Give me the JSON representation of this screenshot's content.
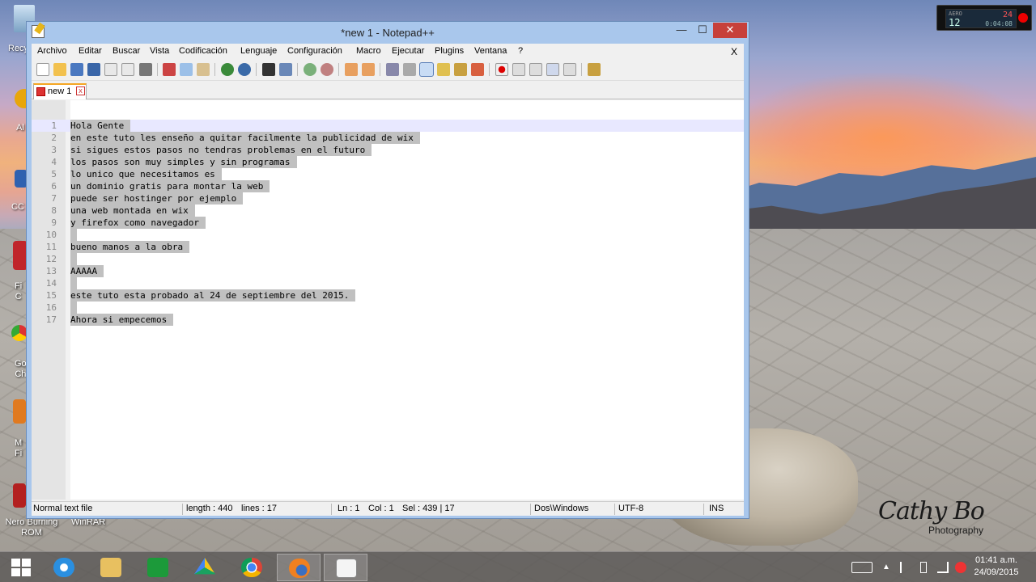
{
  "window": {
    "title": "*new 1 - Notepad++",
    "min": "—",
    "max": "☐",
    "close": "✕"
  },
  "menu": [
    "Archivo",
    "Editar",
    "Buscar",
    "Vista",
    "Codificación",
    "Lenguaje",
    "Configuración",
    "Macro",
    "Ejecutar",
    "Plugins",
    "Ventana",
    "?"
  ],
  "menu_close": "X",
  "tab": {
    "label": "new 1",
    "close": "x"
  },
  "editor": {
    "lines": [
      {
        "n": "1",
        "text": "Hola Gente"
      },
      {
        "n": "2",
        "text": "en este tuto les enseño a quitar facilmente la publicidad de wix"
      },
      {
        "n": "3",
        "text": "si sigues estos pasos no tendras problemas en el futuro"
      },
      {
        "n": "4",
        "text": "los pasos son muy simples y sin programas"
      },
      {
        "n": "5",
        "text": "lo unico que necesitamos es"
      },
      {
        "n": "6",
        "text": "un dominio gratis para montar la web"
      },
      {
        "n": "7",
        "text": "puede ser hostinger por ejemplo"
      },
      {
        "n": "8",
        "text": "una web montada en wix"
      },
      {
        "n": "9",
        "text": "y firefox como navegador"
      },
      {
        "n": "10",
        "text": ""
      },
      {
        "n": "11",
        "text": "bueno manos a la obra"
      },
      {
        "n": "12",
        "text": ""
      },
      {
        "n": "13",
        "text": "AAAAA"
      },
      {
        "n": "14",
        "text": ""
      },
      {
        "n": "15",
        "text": "este tuto esta probado al 24 de septiembre del 2015."
      },
      {
        "n": "16",
        "text": ""
      },
      {
        "n": "17",
        "text": "Ahora si empecemos"
      }
    ]
  },
  "status": {
    "type": "Normal text file",
    "length": "length : 440",
    "lines": "lines : 17",
    "ln": "Ln : 1",
    "col": "Col : 1",
    "sel": "Sel : 439 | 17",
    "eol": "Dos\\Windows",
    "encoding": "UTF-8",
    "mode": "INS"
  },
  "desktop": {
    "icons": [
      {
        "label": "Recy",
        "name": "recycle-bin"
      },
      {
        "label": "Al",
        "name": "desktop-shortcut"
      },
      {
        "label": "CC",
        "name": "desktop-shortcut"
      },
      {
        "label": "Fi\nC",
        "name": "desktop-shortcut"
      },
      {
        "label": "Go\nCh",
        "name": "desktop-shortcut"
      },
      {
        "label": "M\nFi",
        "name": "desktop-shortcut"
      },
      {
        "label": "Nero Burning\nROM",
        "name": "nero-burning-rom"
      },
      {
        "label": "WinRAR",
        "name": "winrar"
      }
    ],
    "photo_credit": "Photography",
    "photo_signature": "Cathy Bo"
  },
  "recorder": {
    "label": "AERO",
    "num": "12",
    "sec": "24",
    "time": "0:04:08"
  },
  "taskbar": {
    "time": "01:41 a.m.",
    "date": "24/09/2015"
  },
  "colors": {
    "selection": "#c0c0c0",
    "window_frame": "#a9c7ec",
    "close_button": "#c7403a",
    "tab_accent": "#f5a623"
  }
}
